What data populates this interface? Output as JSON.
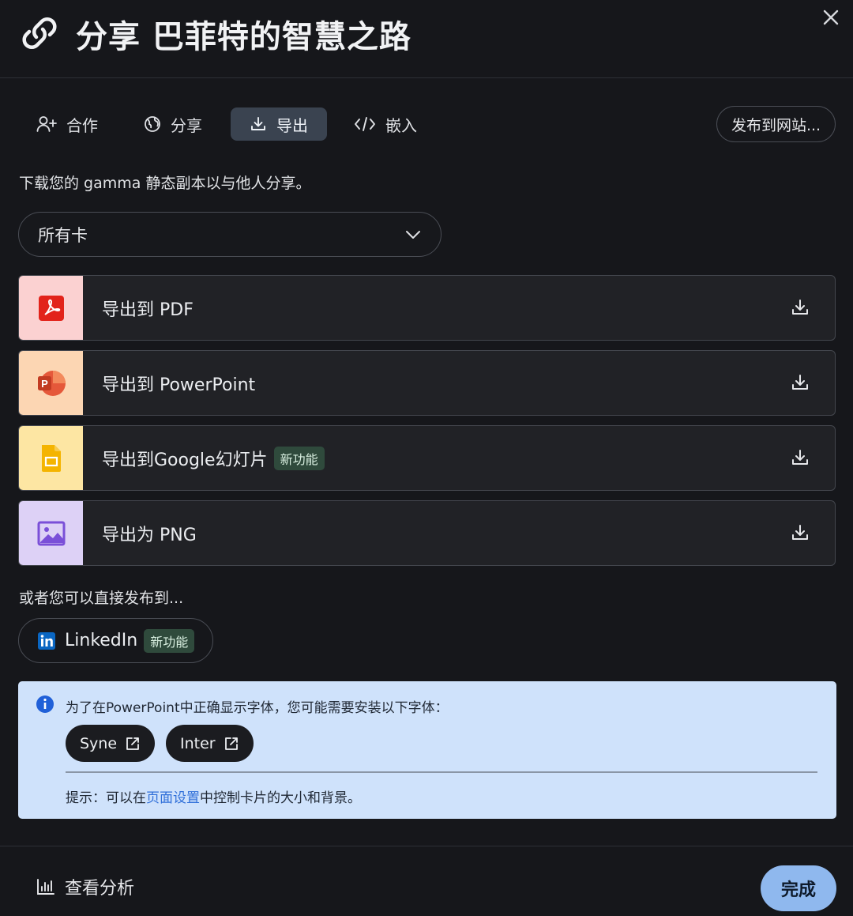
{
  "header": {
    "title": "分享 巴菲特的智慧之路",
    "link_icon": "link-icon",
    "close_icon": "close-icon"
  },
  "tabs": [
    {
      "label": "合作",
      "icon": "user-plus-icon"
    },
    {
      "label": "分享",
      "icon": "globe-icon"
    },
    {
      "label": "导出",
      "icon": "download-icon",
      "active": true
    },
    {
      "label": "嵌入",
      "icon": "code-icon"
    }
  ],
  "publish_label": "发布到网站...",
  "description": "下载您的 gamma 静态副本以与他人分享。",
  "card_select": {
    "selected": "所有卡"
  },
  "exports": [
    {
      "label": "导出到 PDF",
      "icon": "pdf-icon",
      "bg": "#fbd1d1"
    },
    {
      "label": "导出到 PowerPoint",
      "icon": "powerpoint-icon",
      "bg": "#fcd6b3"
    },
    {
      "label": "导出到Google幻灯片",
      "badge": "新功能",
      "icon": "google-slides-icon",
      "bg": "#fde6a3"
    },
    {
      "label": "导出为 PNG",
      "icon": "image-icon",
      "bg": "#ddd1f6"
    }
  ],
  "or_text": "或者您可以直接发布到...",
  "linkedin": {
    "label": "LinkedIn",
    "badge": "新功能"
  },
  "info": {
    "text": "为了在PowerPoint中正确显示字体，您可能需要安装以下字体：",
    "fonts": [
      "Syne",
      "Inter"
    ],
    "tip_prefix": "提示：可以在",
    "tip_link": "页面设置",
    "tip_suffix": "中控制卡片的大小和背景。"
  },
  "footer": {
    "analytics_label": "查看分析",
    "done_label": "完成"
  }
}
